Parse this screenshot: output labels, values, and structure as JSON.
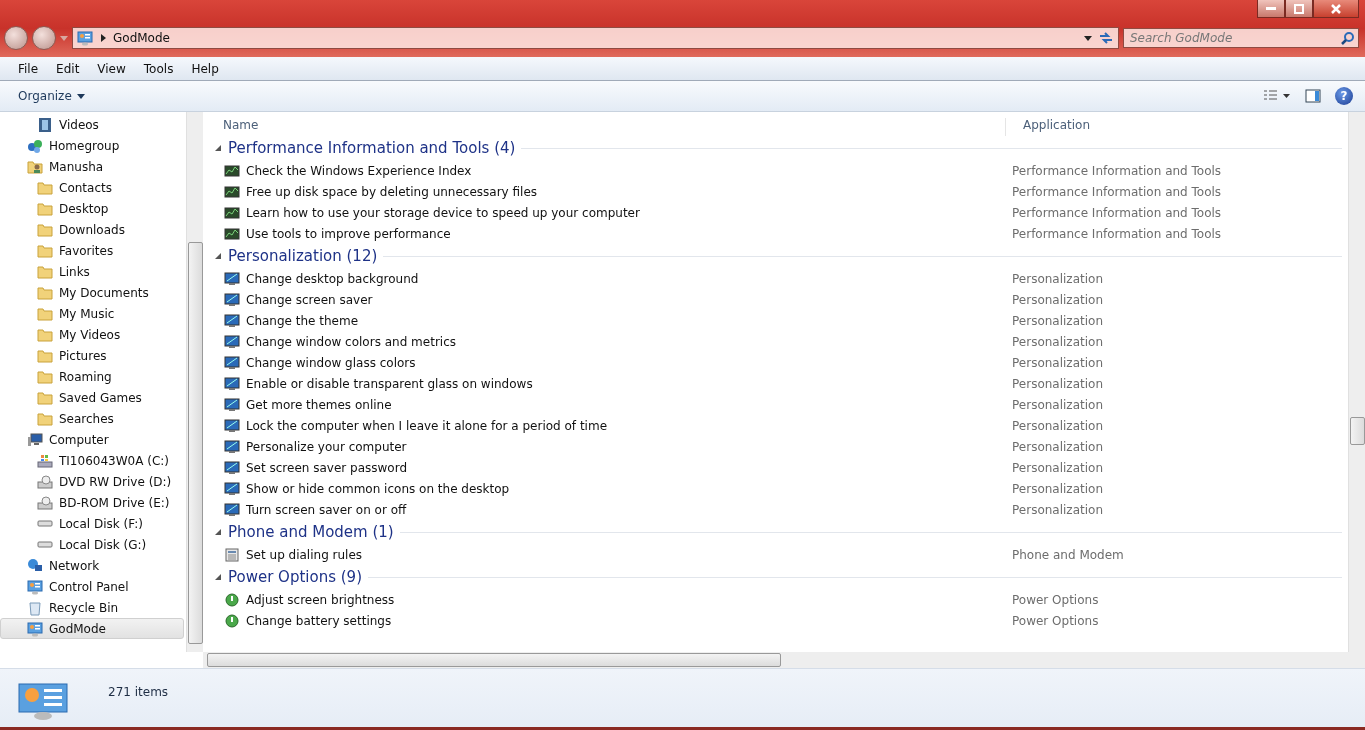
{
  "address_bar": {
    "path": "GodMode",
    "search_placeholder": "Search GodMode"
  },
  "menu": [
    "File",
    "Edit",
    "View",
    "Tools",
    "Help"
  ],
  "toolbar": {
    "organize": "Organize",
    "help": "?"
  },
  "sidebar": {
    "items": [
      {
        "children": [
          {
            "label": "Videos",
            "kind": "video",
            "selected": false
          }
        ]
      },
      {
        "label": "Homegroup",
        "kind": "homegroup",
        "selected": false
      },
      {
        "label": "Manusha",
        "kind": "user",
        "selected": false,
        "children": [
          {
            "label": "Contacts",
            "kind": "folder",
            "selected": false
          },
          {
            "label": "Desktop",
            "kind": "folder",
            "selected": false
          },
          {
            "label": "Downloads",
            "kind": "folder",
            "selected": false
          },
          {
            "label": "Favorites",
            "kind": "folder",
            "selected": false
          },
          {
            "label": "Links",
            "kind": "folder",
            "selected": false
          },
          {
            "label": "My Documents",
            "kind": "folder",
            "selected": false
          },
          {
            "label": "My Music",
            "kind": "folder",
            "selected": false
          },
          {
            "label": "My Videos",
            "kind": "folder",
            "selected": false
          },
          {
            "label": "Pictures",
            "kind": "folder",
            "selected": false
          },
          {
            "label": "Roaming",
            "kind": "folder",
            "selected": false
          },
          {
            "label": "Saved Games",
            "kind": "folder",
            "selected": false
          },
          {
            "label": "Searches",
            "kind": "folder",
            "selected": false
          }
        ]
      },
      {
        "label": "Computer",
        "kind": "computer",
        "selected": false,
        "children": [
          {
            "label": "TI106043W0A (C:)",
            "kind": "drive",
            "selected": false
          },
          {
            "label": "DVD RW Drive (D:)",
            "kind": "disc",
            "selected": false
          },
          {
            "label": "BD-ROM Drive (E:)",
            "kind": "disc",
            "selected": false
          },
          {
            "label": "Local Disk (F:)",
            "kind": "disk",
            "selected": false
          },
          {
            "label": "Local Disk (G:)",
            "kind": "disk",
            "selected": false
          }
        ]
      },
      {
        "label": "Network",
        "kind": "network",
        "selected": false
      },
      {
        "label": "Control Panel",
        "kind": "panel",
        "selected": false
      },
      {
        "label": "Recycle Bin",
        "kind": "bin",
        "selected": false
      },
      {
        "label": "GodMode",
        "kind": "panel",
        "selected": true
      }
    ]
  },
  "table": {
    "columns": [
      "Name",
      "Application"
    ],
    "groups": [
      {
        "title": "Performance Information and Tools (4)",
        "kind": "meter",
        "expanded": true,
        "rows": [
          [
            "Check the Windows Experience Index",
            "Performance Information and Tools"
          ],
          [
            "Free up disk space by deleting unnecessary files",
            "Performance Information and Tools"
          ],
          [
            "Learn how to use your storage device to speed up your computer",
            "Performance Information and Tools"
          ],
          [
            "Use tools to improve performance",
            "Performance Information and Tools"
          ]
        ]
      },
      {
        "title": "Personalization (12)",
        "kind": "monitor",
        "expanded": true,
        "rows": [
          [
            "Change desktop background",
            "Personalization"
          ],
          [
            "Change screen saver",
            "Personalization"
          ],
          [
            "Change the theme",
            "Personalization"
          ],
          [
            "Change window colors and metrics",
            "Personalization"
          ],
          [
            "Change window glass colors",
            "Personalization"
          ],
          [
            "Enable or disable transparent glass on windows",
            "Personalization"
          ],
          [
            "Get more themes online",
            "Personalization"
          ],
          [
            "Lock the computer when I leave it alone for a period of time",
            "Personalization"
          ],
          [
            "Personalize your computer",
            "Personalization"
          ],
          [
            "Set screen saver password",
            "Personalization"
          ],
          [
            "Show or hide common icons on the desktop",
            "Personalization"
          ],
          [
            "Turn screen saver on or off",
            "Personalization"
          ]
        ]
      },
      {
        "title": "Phone and Modem (1)",
        "kind": "phone",
        "expanded": true,
        "rows": [
          [
            "Set up dialing rules",
            "Phone and Modem"
          ]
        ]
      },
      {
        "title": "Power Options (9)",
        "kind": "power",
        "expanded": true,
        "rows": [
          [
            "Adjust screen brightness",
            "Power Options"
          ],
          [
            "Change battery settings",
            "Power Options"
          ]
        ]
      }
    ]
  },
  "status_bar": {
    "count": "271 items"
  }
}
